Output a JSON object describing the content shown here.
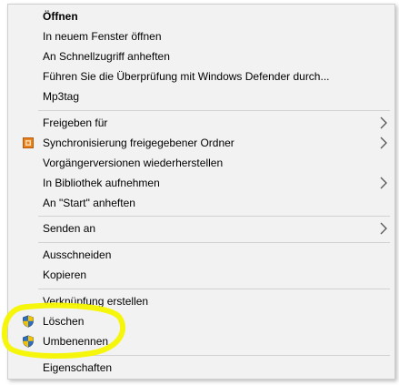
{
  "menu": {
    "items": [
      {
        "label": "Öffnen"
      },
      {
        "label": "In neuem Fenster öffnen"
      },
      {
        "label": "An Schnellzugriff anheften"
      },
      {
        "label": "Führen Sie die Überprüfung mit Windows Defender durch..."
      },
      {
        "label": "Mp3tag"
      },
      {
        "label": "Freigeben für"
      },
      {
        "label": "Synchronisierung freigegebener Ordner"
      },
      {
        "label": "Vorgängerversionen wiederherstellen"
      },
      {
        "label": "In Bibliothek aufnehmen"
      },
      {
        "label": "An \"Start\" anheften"
      },
      {
        "label": "Senden an"
      },
      {
        "label": "Ausschneiden"
      },
      {
        "label": "Kopieren"
      },
      {
        "label": "Verknüpfung erstellen"
      },
      {
        "label": "Löschen"
      },
      {
        "label": "Umbenennen"
      },
      {
        "label": "Eigenschaften"
      }
    ]
  },
  "annotation": {
    "color": "#f5f500"
  },
  "colors": {
    "menu_background": "#f2f2f2",
    "separator": "#d2d2d2",
    "chevron": "#555555",
    "shield_blue": "#2f6fbf",
    "shield_yellow": "#f2c200",
    "sync_orange": "#e8821e"
  },
  "icons": {
    "sync": "sync-folder-icon",
    "shield": "uac-shield-icon",
    "submenu": "chevron-right-icon"
  }
}
